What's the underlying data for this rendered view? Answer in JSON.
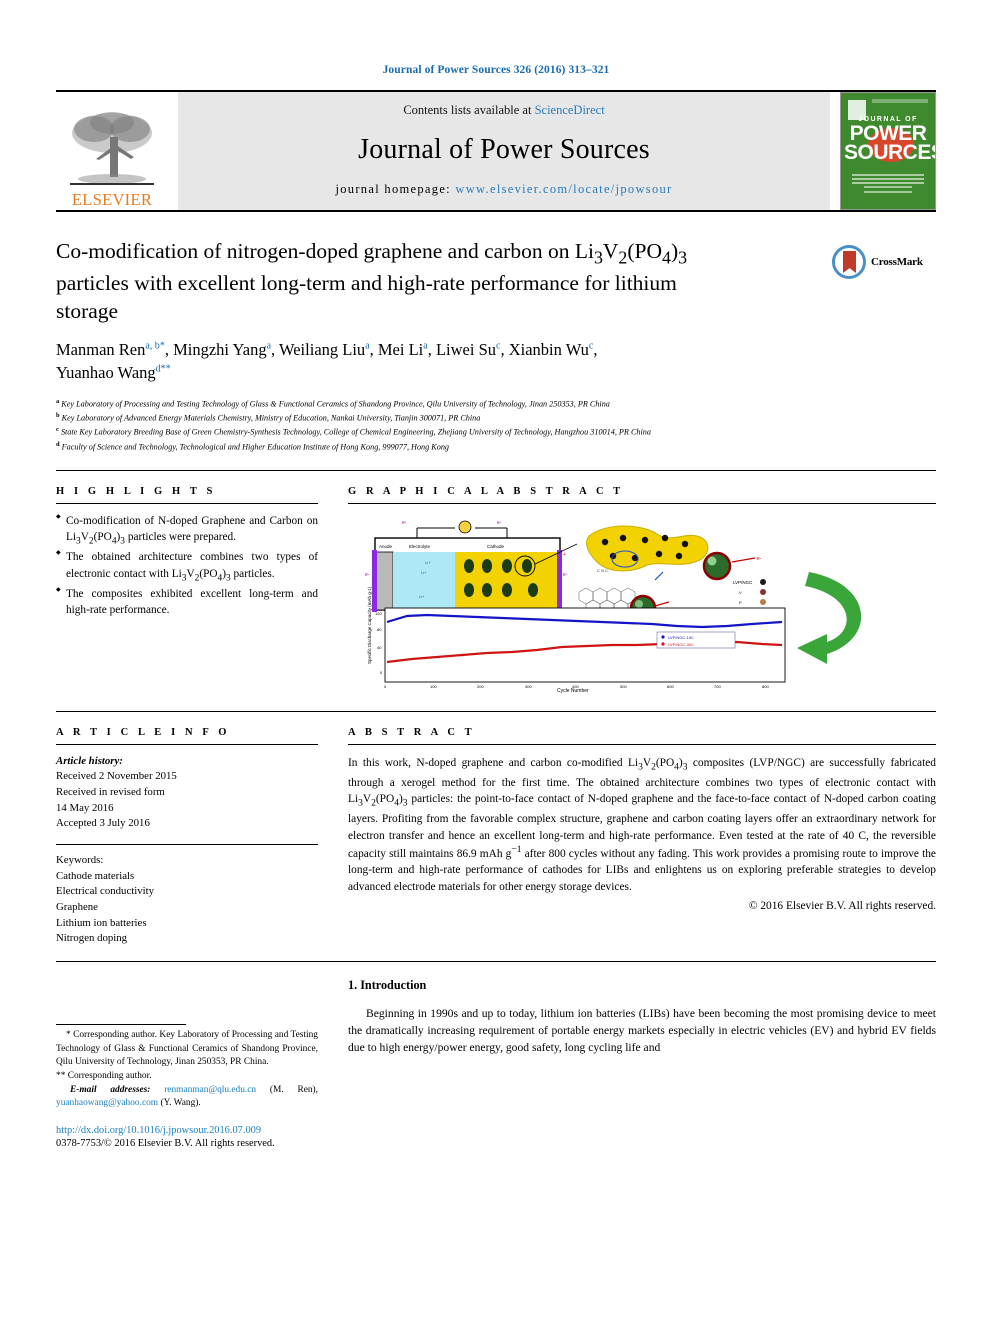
{
  "running_head": "Journal of Power Sources 326 (2016) 313–321",
  "masthead": {
    "contents_prefix": "Contents lists available at ",
    "contents_link": "ScienceDirect",
    "journal_title": "Journal of Power Sources",
    "homepage_prefix": "journal homepage: ",
    "homepage_url": "www.elsevier.com/locate/jpowsour",
    "publisher": "ELSEVIER",
    "cover": {
      "line1": "JOURNAL OF",
      "line2": "POWER",
      "line3": "SOURCES"
    }
  },
  "article": {
    "title": "Co-modification of nitrogen-doped graphene and carbon on Li3V2(PO4)3 particles with excellent long-term and high-rate performance for lithium storage",
    "title_parts": [
      {
        "t": "Co-modification of nitrogen-doped graphene and carbon on "
      },
      {
        "t": "Li",
        "sub": "3"
      },
      {
        "t": "V",
        "sub": "2"
      },
      {
        "t": "(PO",
        "sub": "4"
      },
      {
        "t": ")",
        "sub": "3"
      },
      {
        "t": " particles with excellent long-term and high-rate performance for lithium storage"
      }
    ],
    "crossmark_label": "CrossMark",
    "authors": [
      {
        "name": "Manman Ren",
        "marks": "a, b",
        "star": "*"
      },
      {
        "name": "Mingzhi Yang",
        "marks": "a",
        "star": ""
      },
      {
        "name": "Weiliang Liu",
        "marks": "a",
        "star": ""
      },
      {
        "name": "Mei Li",
        "marks": "a",
        "star": ""
      },
      {
        "name": "Liwei Su",
        "marks": "c",
        "star": ""
      },
      {
        "name": "Xianbin Wu",
        "marks": "c",
        "star": ""
      },
      {
        "name": "Yuanhao Wang",
        "marks": "d",
        "star": "**"
      }
    ],
    "affiliations": [
      {
        "mark": "a",
        "text": "Key Laboratory of Processing and Testing Technology of Glass & Functional Ceramics of Shandong Province, Qilu University of Technology, Jinan 250353, PR China"
      },
      {
        "mark": "b",
        "text": "Key Laboratory of Advanced Energy Materials Chemistry, Ministry of Education, Nankai University, Tianjin 300071, PR China"
      },
      {
        "mark": "c",
        "text": "State Key Laboratory Breeding Base of Green Chemistry-Synthesis Technology, College of Chemical Engineering, Zhejiang University of Technology, Hangzhou 310014, PR China"
      },
      {
        "mark": "d",
        "text": "Faculty of Science and Technology, Technological and Higher Education Institute of Hong Kong, 999077, Hong Kong"
      }
    ]
  },
  "sections": {
    "highlights_heading": "H I G H L I G H T S",
    "graphical_abstract_heading": "G R A P H I C A L   A B S T R A C T",
    "article_info_heading": "A R T I C L E   I N F O",
    "abstract_heading": "A B S T R A C T"
  },
  "highlights": [
    "Co-modification of N-doped Graphene and Carbon on Li3V2(PO4)3 particles were prepared.",
    "The obtained architecture combines two types of electronic contact with Li3V2(PO4)3 particles.",
    "The composites exhibited excellent long-term and high-rate performance."
  ],
  "article_info": {
    "history_label": "Article history:",
    "received": "Received 2 November 2015",
    "revised_label": "Received in revised form",
    "revised_date": "14 May 2016",
    "accepted": "Accepted 3 July 2016",
    "keywords_label": "Keywords:",
    "keywords": [
      "Cathode materials",
      "Electrical conductivity",
      "Graphene",
      "Lithium ion batteries",
      "Nitrogen doping"
    ]
  },
  "abstract": {
    "text": "In this work, N-doped graphene and carbon co-modified Li3V2(PO4)3 composites (LVP/NGC) are successfully fabricated through a xerogel method for the first time. The obtained architecture combines two types of electronic contact with Li3V2(PO4)3 particles: the point-to-face contact of N-doped graphene and the face-to-face contact of N-doped carbon coating layers. Profiting from the favorable complex structure, graphene and carbon coating layers offer an extraordinary network for electron transfer and hence an excellent long-term and high-rate performance. Even tested at the rate of 40 C, the reversible capacity still maintains 86.9 mAh g-1 after 800 cycles without any fading. This work provides a promising route to improve the long-term and high-rate performance of cathodes for LIBs and enlightens us on exploring preferable strategies to develop advanced electrode materials for other energy storage devices.",
    "copyright": "© 2016 Elsevier B.V. All rights reserved."
  },
  "graphical_abstract": {
    "chart_axis_y": "Specific Discharge Capacity (mAh g-1)",
    "chart_axis_x": "Cycle Number",
    "legend": [
      "LVP/NGC-10C",
      "LVP/NGC-40C"
    ],
    "cell_labels": [
      "Anode",
      "Electrolyte",
      "Cathode"
    ]
  },
  "footnotes": {
    "star": "* Corresponding author. Key Laboratory of Processing and Testing Technology of Glass & Functional Ceramics of Shandong Province, Qilu University of Technology, Jinan 250353, PR China.",
    "doublestar": "** Corresponding author.",
    "email_label": "E-mail addresses:",
    "email1": "renmanman@qlu.edu.cn",
    "email1_who": "(M. Ren),",
    "email2": "yuanhaowang@yahoo.com",
    "email2_who": "(Y. Wang)."
  },
  "footer": {
    "doi": "http://dx.doi.org/10.1016/j.jpowsour.2016.07.009",
    "issn": "0378-7753/© 2016 Elsevier B.V. All rights reserved."
  },
  "introduction": {
    "heading": "1.  Introduction",
    "paragraph": "Beginning in 1990s and up to today, lithium ion batteries (LIBs) have been becoming the most promising device to meet the dramatically increasing requirement of portable energy markets especially in electric vehicles (EV) and hybrid EV fields due to high energy/power energy, good safety, long cycling life and"
  },
  "chart_data": {
    "type": "line",
    "title": "",
    "xlabel": "Cycle Number",
    "ylabel": "Specific Discharge Capacity (mAh g-1)",
    "xlim": [
      0,
      800
    ],
    "ylim": [
      0,
      130
    ],
    "xticks": [
      0,
      100,
      200,
      300,
      400,
      500,
      600,
      700,
      800
    ],
    "yticks": [
      0,
      20,
      40,
      60,
      80,
      100,
      120
    ],
    "legend_position": "center-right",
    "grid": false,
    "series": [
      {
        "name": "LVP/NGC-10C",
        "color": "#1414c8",
        "x": [
          0,
          50,
          100,
          150,
          200,
          250,
          300,
          350,
          400,
          450,
          500,
          550,
          600,
          650,
          700,
          750,
          800
        ],
        "values": [
          104,
          112,
          111,
          110,
          109,
          108,
          106,
          104,
          103,
          102,
          101,
          100,
          99,
          97,
          96,
          98,
          101
        ]
      },
      {
        "name": "LVP/NGC-40C",
        "color": "#d01414",
        "x": [
          0,
          50,
          100,
          150,
          200,
          250,
          300,
          350,
          400,
          450,
          500,
          550,
          600,
          650,
          700,
          750,
          800
        ],
        "values": [
          44,
          48,
          52,
          54,
          56,
          58,
          60,
          62,
          66,
          67,
          68,
          68,
          69,
          69,
          70,
          71,
          69
        ]
      }
    ]
  }
}
